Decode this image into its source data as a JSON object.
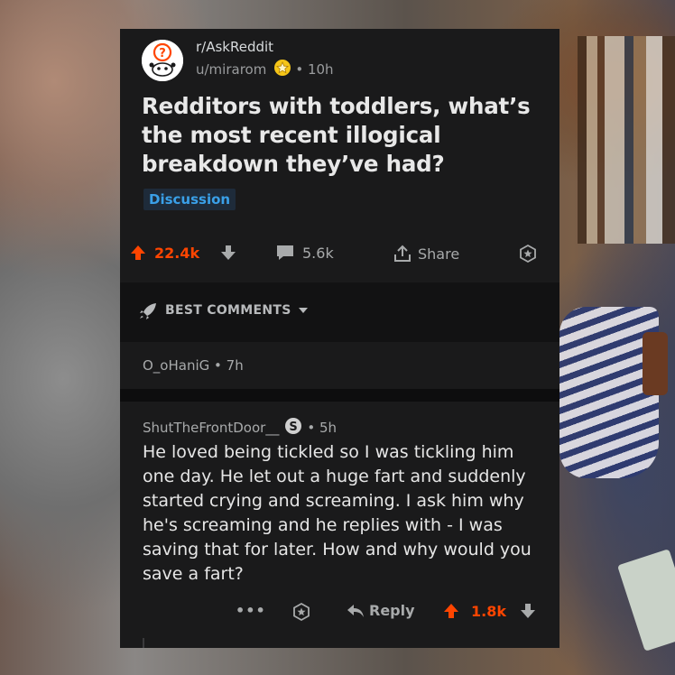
{
  "post": {
    "subreddit": "r/AskReddit",
    "username": "u/mirarom",
    "time": "10h",
    "title": "Redditors with toddlers, what’s the most recent illogical breakdown they’ve had?",
    "flair": "Discussion",
    "upvotes": "22.4k",
    "comments": "5.6k",
    "share_label": "Share"
  },
  "sort": {
    "label": "BEST COMMENTS"
  },
  "comments": [
    {
      "author": "O_oHaniG",
      "time": "7h"
    },
    {
      "author": "ShutTheFrontDoor__",
      "time": "5h",
      "body": "He loved being tickled so I was tickling him one day. He let out a huge fart and suddenly started crying and screaming. I ask him why he's screaming and he replies with - I was saving that for later. How and why would you save a fart?",
      "reply_label": "Reply",
      "upvotes": "1.8k"
    }
  ],
  "colors": {
    "upvote": "#ff4500",
    "card_bg": "#1a1a1b",
    "flair_text": "#3aa0e8"
  },
  "icons": [
    "reddit-snoo-icon",
    "award-icon",
    "upvote-icon",
    "downvote-icon",
    "comment-icon",
    "share-icon",
    "save-star-icon",
    "rocket-icon",
    "chevron-down-icon",
    "more-icon",
    "reply-icon",
    "mod-badge-icon"
  ]
}
